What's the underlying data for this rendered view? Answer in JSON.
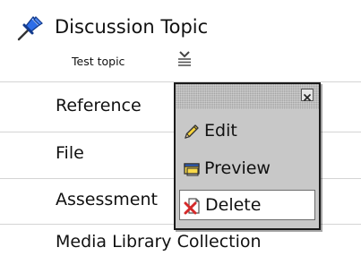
{
  "header": {
    "title": "Discussion Topic",
    "icon": "pushpin-icon"
  },
  "subtitle": {
    "text": "Test topic",
    "dropdown_icon": "chevron-menu-icon"
  },
  "rows": [
    {
      "label": "Reference"
    },
    {
      "label": "File"
    },
    {
      "label": "Assessment"
    },
    {
      "label": "Media Library Collection"
    }
  ],
  "popup": {
    "close_icon": "close-icon",
    "items": [
      {
        "label": "Edit",
        "icon": "pencil-icon",
        "selected": false
      },
      {
        "label": "Preview",
        "icon": "window-icon",
        "selected": false
      },
      {
        "label": "Delete",
        "icon": "delete-document-icon",
        "selected": true
      }
    ]
  },
  "colors": {
    "divider": "#d4d4d4",
    "popup_background": "#c8c8c8",
    "popup_header": "#a4a4a4",
    "popup_border": "#1a1a1a",
    "selected_item": "#ffffff",
    "delete_red": "#d42a2a",
    "pencil_yellow": "#f6d33c",
    "window_yellow": "#f8d94a",
    "window_titlebar": "#2c62c8"
  }
}
